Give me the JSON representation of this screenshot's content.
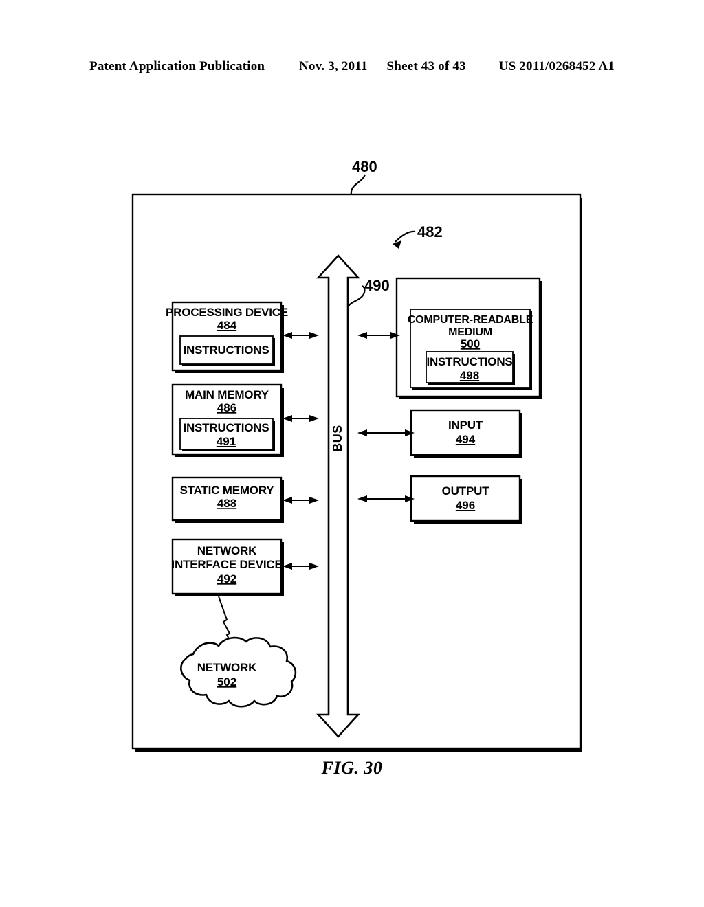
{
  "header": {
    "publication": "Patent Application Publication",
    "date": "Nov. 3, 2011",
    "sheet": "Sheet 43 of 43",
    "patent_number": "US 2011/0268452 A1"
  },
  "figure": {
    "caption": "FIG. 30",
    "system_ref": "480",
    "bus_arrow_ref": "482",
    "bus_line_ref": "490",
    "bus_label": "BUS"
  },
  "blocks": {
    "processing_device": {
      "title": "PROCESSING DEVICE",
      "ref": "484",
      "inner": {
        "title": "INSTRUCTIONS",
        "ref": ""
      }
    },
    "main_memory": {
      "title": "MAIN MEMORY",
      "ref": "486",
      "inner": {
        "title": "INSTRUCTIONS",
        "ref": "491"
      }
    },
    "static_memory": {
      "title": "STATIC MEMORY",
      "ref": "488"
    },
    "network_interface_device": {
      "title_line1": "NETWORK",
      "title_line2": "INTERFACE DEVICE",
      "ref": "492"
    },
    "computer_readable_medium": {
      "title_line1": "COMPUTER-READABLE",
      "title_line2": "MEDIUM",
      "ref": "500",
      "inner": {
        "title": "INSTRUCTIONS",
        "ref": "498"
      }
    },
    "input": {
      "title": "INPUT",
      "ref": "494"
    },
    "output": {
      "title": "OUTPUT",
      "ref": "496"
    },
    "network": {
      "title": "NETWORK",
      "ref": "502"
    }
  },
  "colors": {
    "ink": "#000000",
    "paper": "#ffffff"
  }
}
